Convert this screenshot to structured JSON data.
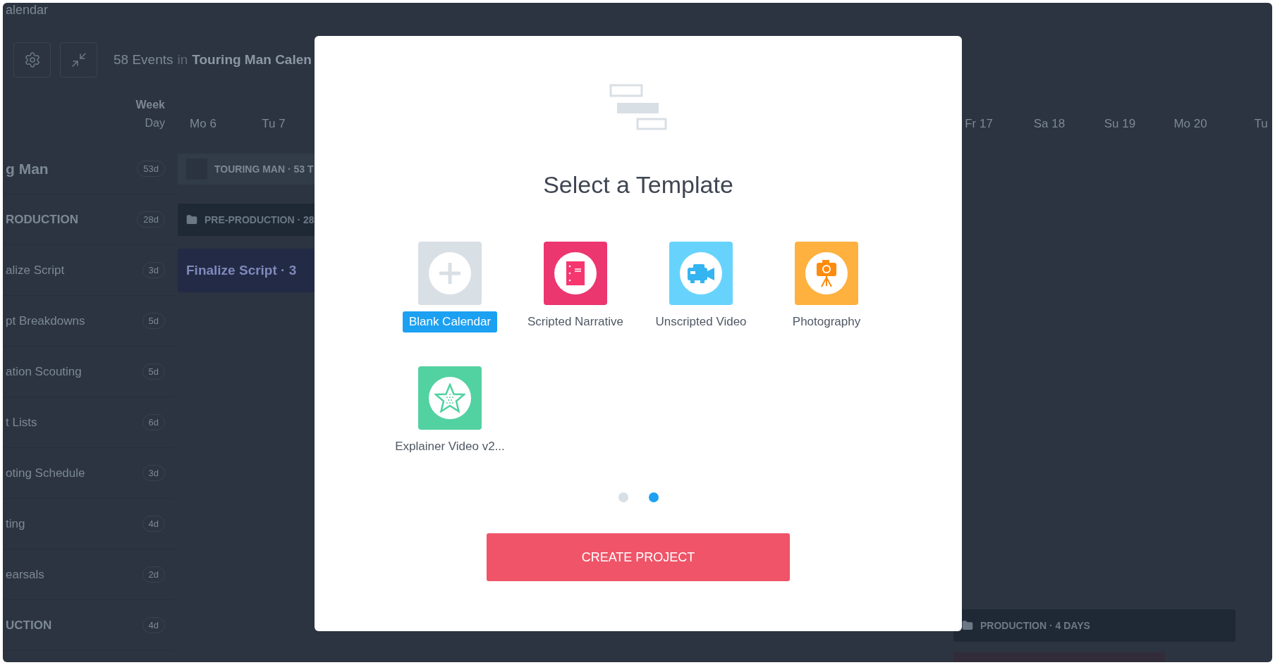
{
  "app": {
    "title": "alendar",
    "toolbar": {
      "summary_count": "58 Events",
      "summary_in": "in",
      "summary_name": "Touring Man Calen"
    },
    "timeline": {
      "week_label": "Week",
      "day_label": "Day",
      "days_left": [
        "Mo 6",
        "Tu 7"
      ],
      "days_right": [
        "Fr 17",
        "Sa 18",
        "Su 19",
        "Mo 20",
        "Tu"
      ]
    },
    "sidebar": {
      "rows": [
        {
          "label": "g Man",
          "duration": "53d",
          "kind": "project"
        },
        {
          "label": "RODUCTION",
          "duration": "28d",
          "kind": "phase"
        },
        {
          "label": "alize Script",
          "duration": "3d",
          "kind": "task"
        },
        {
          "label": "pt Breakdowns",
          "duration": "5d",
          "kind": "task"
        },
        {
          "label": "ation Scouting",
          "duration": "5d",
          "kind": "task"
        },
        {
          "label": "t Lists",
          "duration": "6d",
          "kind": "task"
        },
        {
          "label": "oting Schedule",
          "duration": "3d",
          "kind": "task"
        },
        {
          "label": "ting",
          "duration": "4d",
          "kind": "task"
        },
        {
          "label": "earsals",
          "duration": "2d",
          "kind": "task"
        },
        {
          "label": "UCTION",
          "duration": "4d",
          "kind": "phase"
        }
      ]
    },
    "bars": [
      {
        "label": "TOURING MAN · 53 T",
        "kind": "project"
      },
      {
        "label": "PRE-PRODUCTION · 28",
        "kind": "phase"
      },
      {
        "label": "Finalize Script · 3",
        "kind": "task"
      },
      {
        "label": "PRODUCTION · 4 DAYS",
        "kind": "phase"
      }
    ]
  },
  "modal": {
    "title": "Select a Template",
    "templates": [
      {
        "label": "Blank Calendar",
        "kind": "blank",
        "color": "#d8dfe5",
        "selected": true
      },
      {
        "label": "Scripted Narrative",
        "kind": "scripted",
        "color": "#ec3670",
        "selected": false
      },
      {
        "label": "Unscripted Video",
        "kind": "unscripted",
        "color": "#67d3fd",
        "selected": false
      },
      {
        "label": "Photography",
        "kind": "photo",
        "color": "#feb13f",
        "selected": false
      },
      {
        "label": "Explainer Video v2...",
        "kind": "explainer",
        "color": "#52d1a1",
        "selected": false
      }
    ],
    "pages": [
      {
        "selected": false
      },
      {
        "selected": true
      }
    ],
    "button": "CREATE PROJECT"
  }
}
